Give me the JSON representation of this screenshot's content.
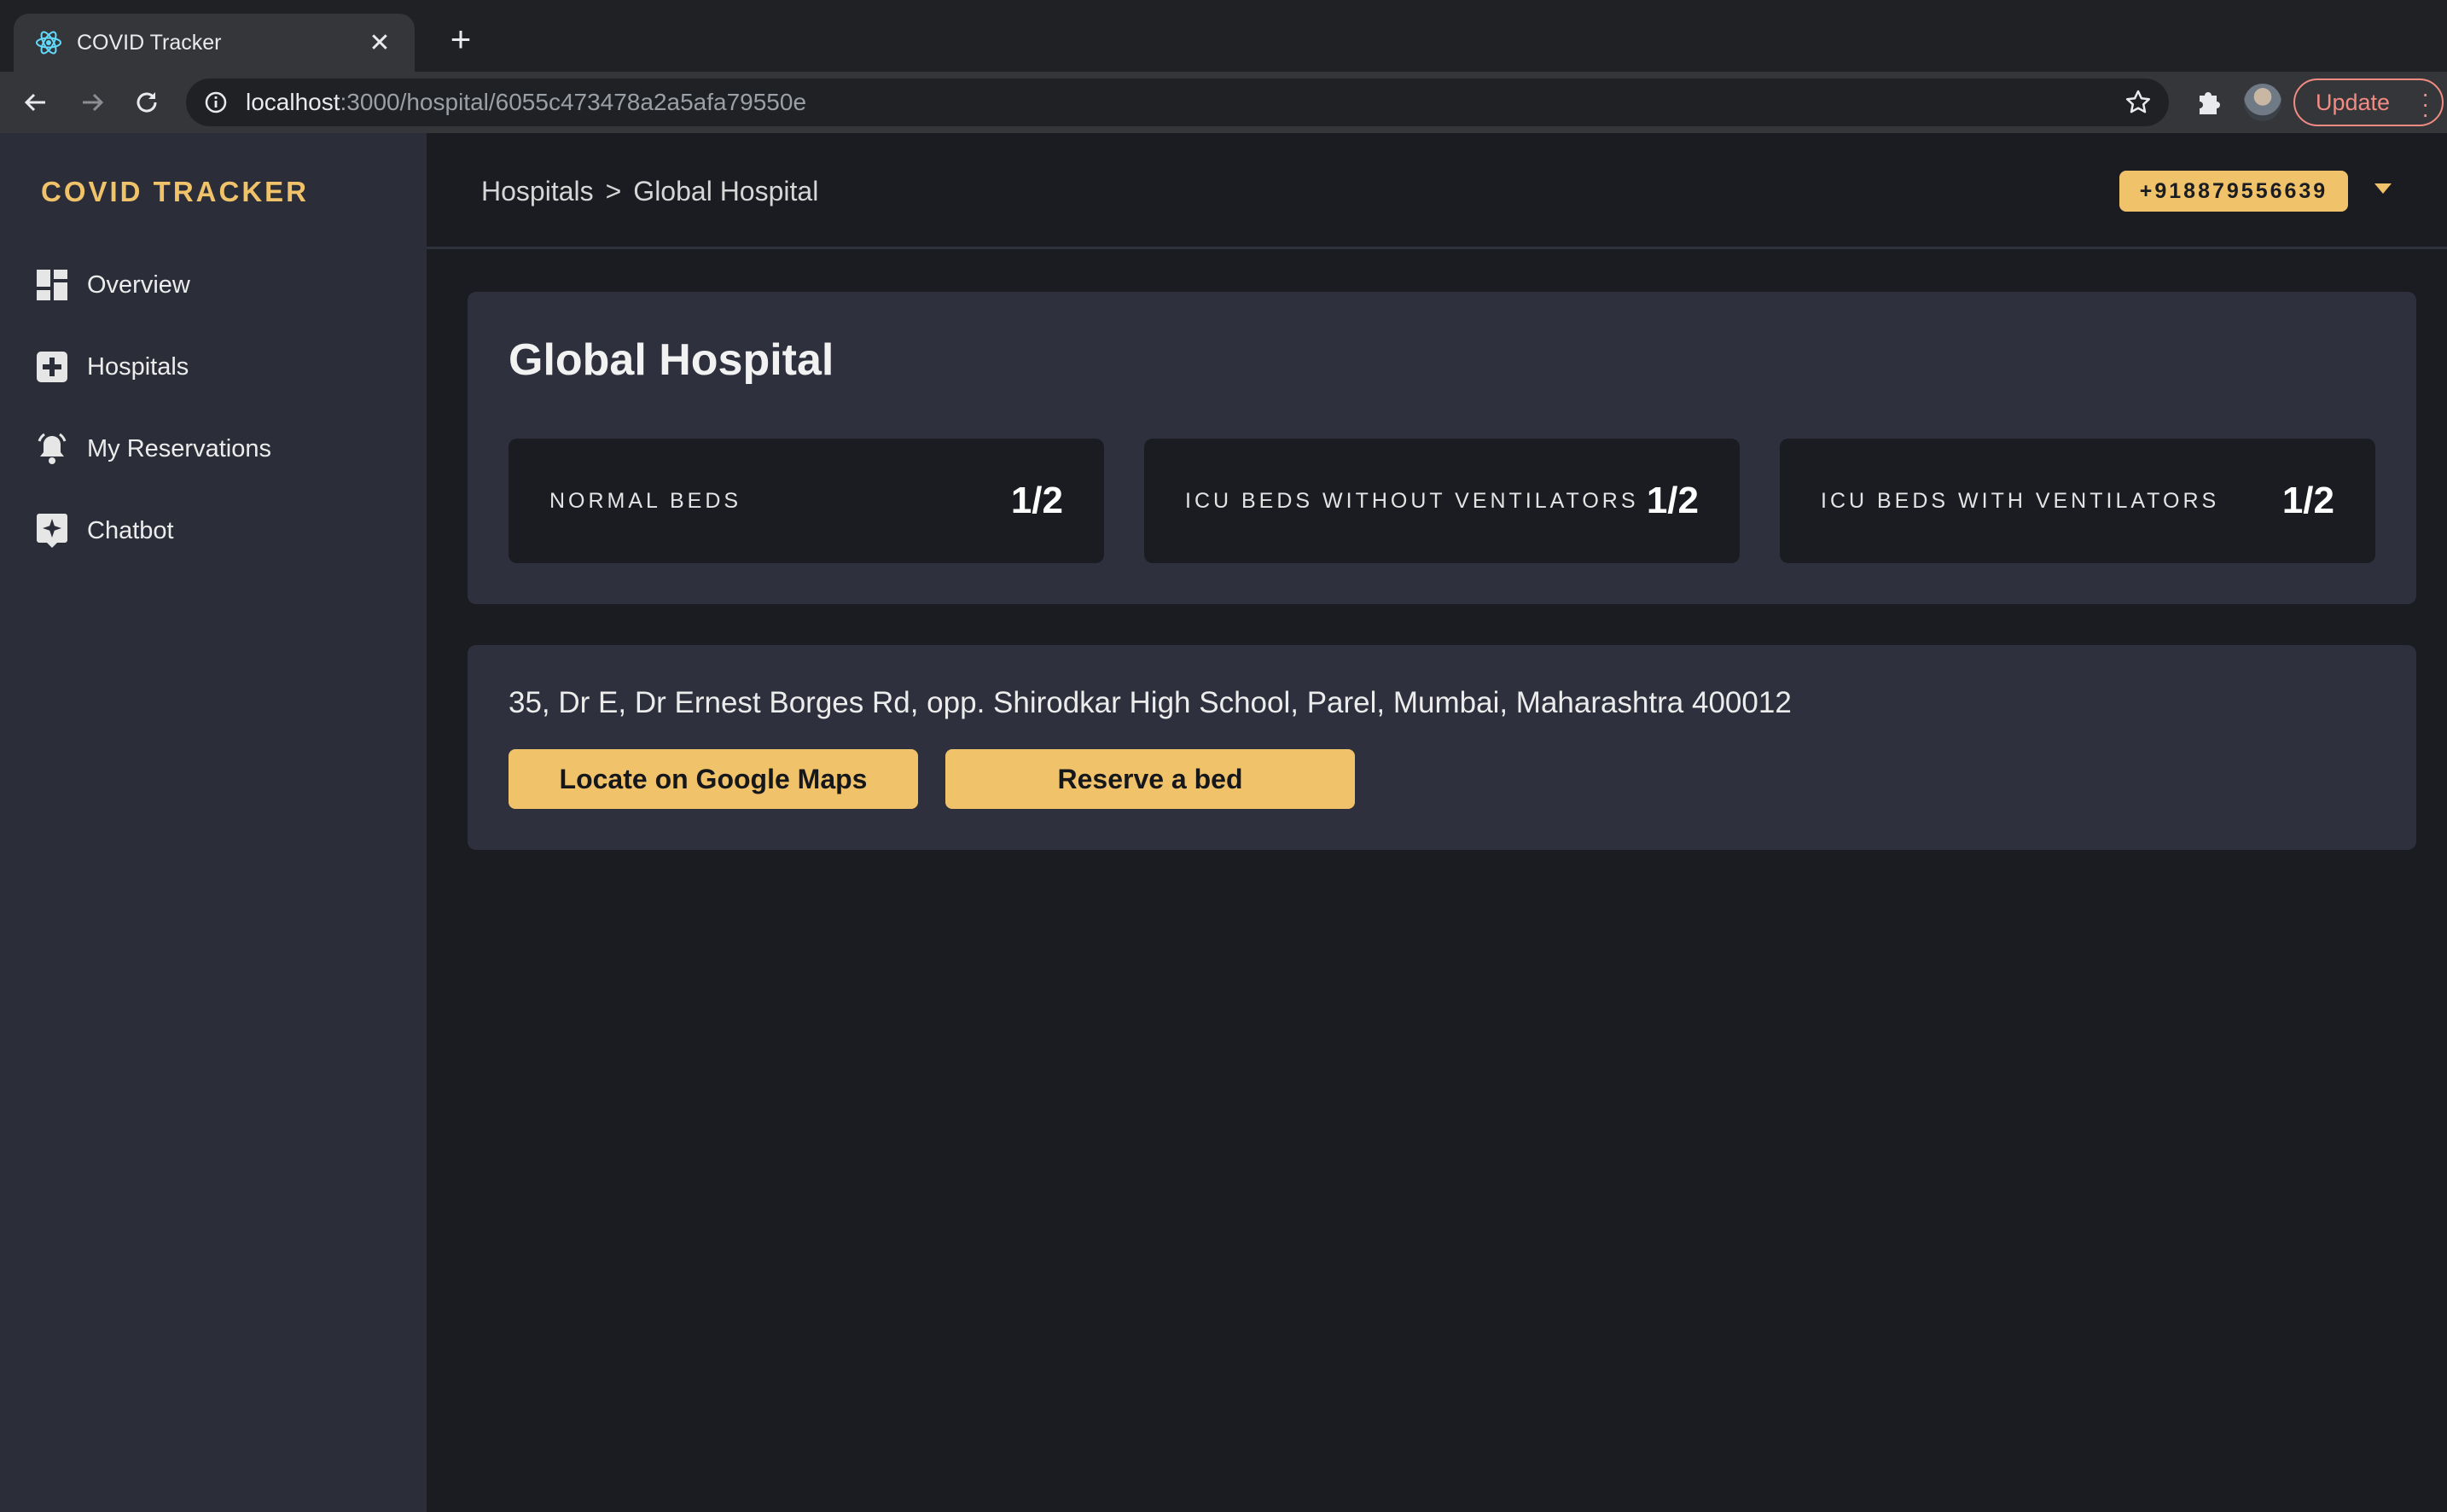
{
  "browser": {
    "tab_title": "COVID Tracker",
    "new_tab_label": "+",
    "url_host": "localhost",
    "url_path": ":3000/hospital/6055c473478a2a5afa79550e",
    "update_label": "Update"
  },
  "sidebar": {
    "brand": "COVID TRACKER",
    "items": [
      {
        "label": "Overview",
        "icon": "dashboard-icon"
      },
      {
        "label": "Hospitals",
        "icon": "hospital-plus-icon"
      },
      {
        "label": "My Reservations",
        "icon": "alarm-bell-icon"
      },
      {
        "label": "Chatbot",
        "icon": "sparkle-chat-icon"
      }
    ]
  },
  "header": {
    "breadcrumb": [
      "Hospitals",
      ">",
      "Global Hospital"
    ],
    "phone": "+918879556639"
  },
  "hospital": {
    "name": "Global Hospital",
    "stats": [
      {
        "label": "NORMAL BEDS",
        "value": "1/2"
      },
      {
        "label": "ICU BEDS WITHOUT VENTILATORS",
        "value": "1/2"
      },
      {
        "label": "ICU BEDS WITH VENTILATORS",
        "value": "1/2"
      }
    ],
    "address": "35, Dr E, Dr Ernest Borges Rd, opp. Shirodkar High School, Parel, Mumbai, Maharashtra 400012",
    "actions": {
      "locate": "Locate on Google Maps",
      "reserve": "Reserve a bed"
    }
  },
  "colors": {
    "accent": "#f0c36b",
    "background": "#1b1c21",
    "sidebar": "#2b2d38",
    "card": "#2e303d"
  }
}
